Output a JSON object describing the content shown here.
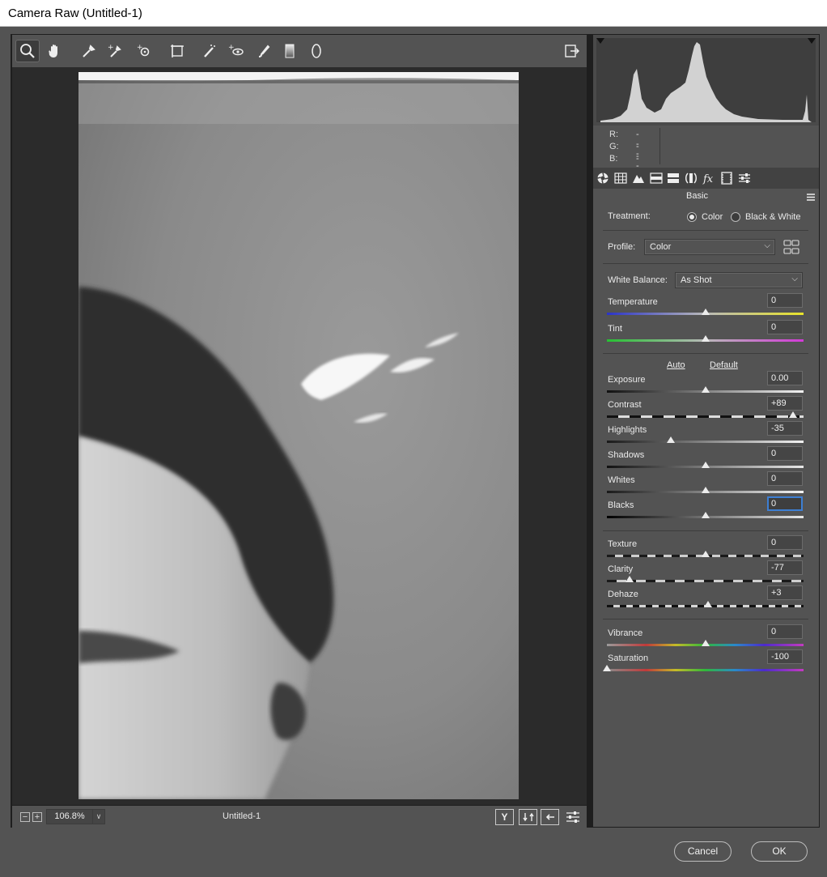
{
  "window": {
    "title": "Camera Raw (Untitled-1)"
  },
  "toolbar": {
    "tools": [
      "zoom-tool",
      "hand-tool",
      "white-balance-tool",
      "color-sampler-tool",
      "targeted-adjustment-tool",
      "transform-tool",
      "spot-removal-tool",
      "red-eye-tool",
      "adjustment-brush-tool",
      "graduated-filter-tool",
      "radial-filter-tool"
    ],
    "active_tool": "zoom-tool"
  },
  "status": {
    "zoom_minus": "−",
    "zoom_plus": "+",
    "zoom_value": "106.8%",
    "zoom_dropdown": "∨",
    "filename": "Untitled-1",
    "before_after_label": "Y"
  },
  "rgb": {
    "r_label": "R:",
    "g_label": "G:",
    "b_label": "B:",
    "r": "---",
    "g": "---",
    "b": "---"
  },
  "panel": {
    "title": "Basic"
  },
  "treatment": {
    "label": "Treatment:",
    "color": "Color",
    "bw": "Black & White",
    "selected": "color"
  },
  "profile": {
    "label": "Profile:",
    "value": "Color"
  },
  "white_balance": {
    "label": "White Balance:",
    "value": "As Shot"
  },
  "links": {
    "auto": "Auto",
    "default": "Default"
  },
  "sliders": {
    "temperature": {
      "label": "Temperature",
      "value": "0",
      "position": 0.5
    },
    "tint": {
      "label": "Tint",
      "value": "0",
      "position": 0.5
    },
    "exposure": {
      "label": "Exposure",
      "value": "0.00",
      "position": 0.5
    },
    "contrast": {
      "label": "Contrast",
      "value": "+89",
      "position": 0.945
    },
    "highlights": {
      "label": "Highlights",
      "value": "-35",
      "position": 0.325
    },
    "shadows": {
      "label": "Shadows",
      "value": "0",
      "position": 0.5
    },
    "whites": {
      "label": "Whites",
      "value": "0",
      "position": 0.5
    },
    "blacks": {
      "label": "Blacks",
      "value": "0",
      "position": 0.5
    },
    "texture": {
      "label": "Texture",
      "value": "0",
      "position": 0.5
    },
    "clarity": {
      "label": "Clarity",
      "value": "-77",
      "position": 0.115
    },
    "dehaze": {
      "label": "Dehaze",
      "value": "+3",
      "position": 0.515
    },
    "vibrance": {
      "label": "Vibrance",
      "value": "0",
      "position": 0.5
    },
    "saturation": {
      "label": "Saturation",
      "value": "-100",
      "position": 0.0
    }
  },
  "buttons": {
    "cancel": "Cancel",
    "ok": "OK"
  },
  "colors": {
    "focus": "#3d7fd3",
    "panel": "#535353",
    "track_dark": "#1a1a1a"
  }
}
